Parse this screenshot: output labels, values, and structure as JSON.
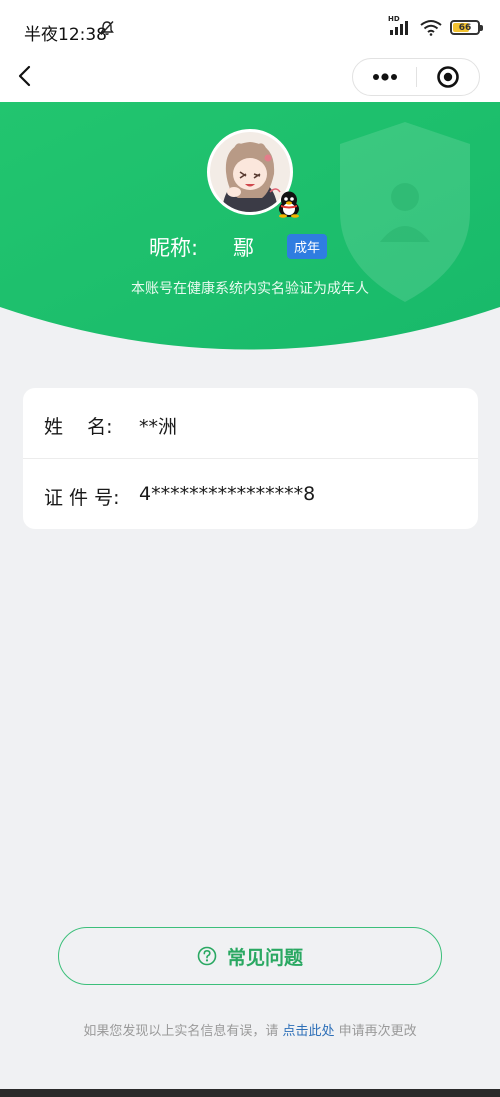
{
  "status_bar": {
    "time": "半夜12:38",
    "hd_label": "HD",
    "battery_level": "66",
    "battery_fraction": 0.66
  },
  "nav": {
    "back_icon": "chevron-left-icon",
    "more_icon": "more-dots-icon",
    "close_icon": "target-close-icon"
  },
  "profile": {
    "nickname_label": "昵称:",
    "nickname_value": "鄢",
    "age_badge": "成年",
    "verify_desc": "本账号在健康系统内实名验证为成年人"
  },
  "info": {
    "rows": [
      {
        "label": "姓    名:",
        "value": "**洲"
      },
      {
        "label": "证 件 号:",
        "value": "4****************8"
      }
    ]
  },
  "faq": {
    "label": "常见问题",
    "icon": "question-circle-icon"
  },
  "footer": {
    "prefix": "如果您发现以上实名信息有误，请",
    "link": "点击此处",
    "suffix": "申请再次更改"
  },
  "colors": {
    "hero_green": "#1fbf6e",
    "badge_blue": "#2f7de1",
    "faq_green": "#2aa862",
    "link_blue": "#2d6fb8"
  }
}
